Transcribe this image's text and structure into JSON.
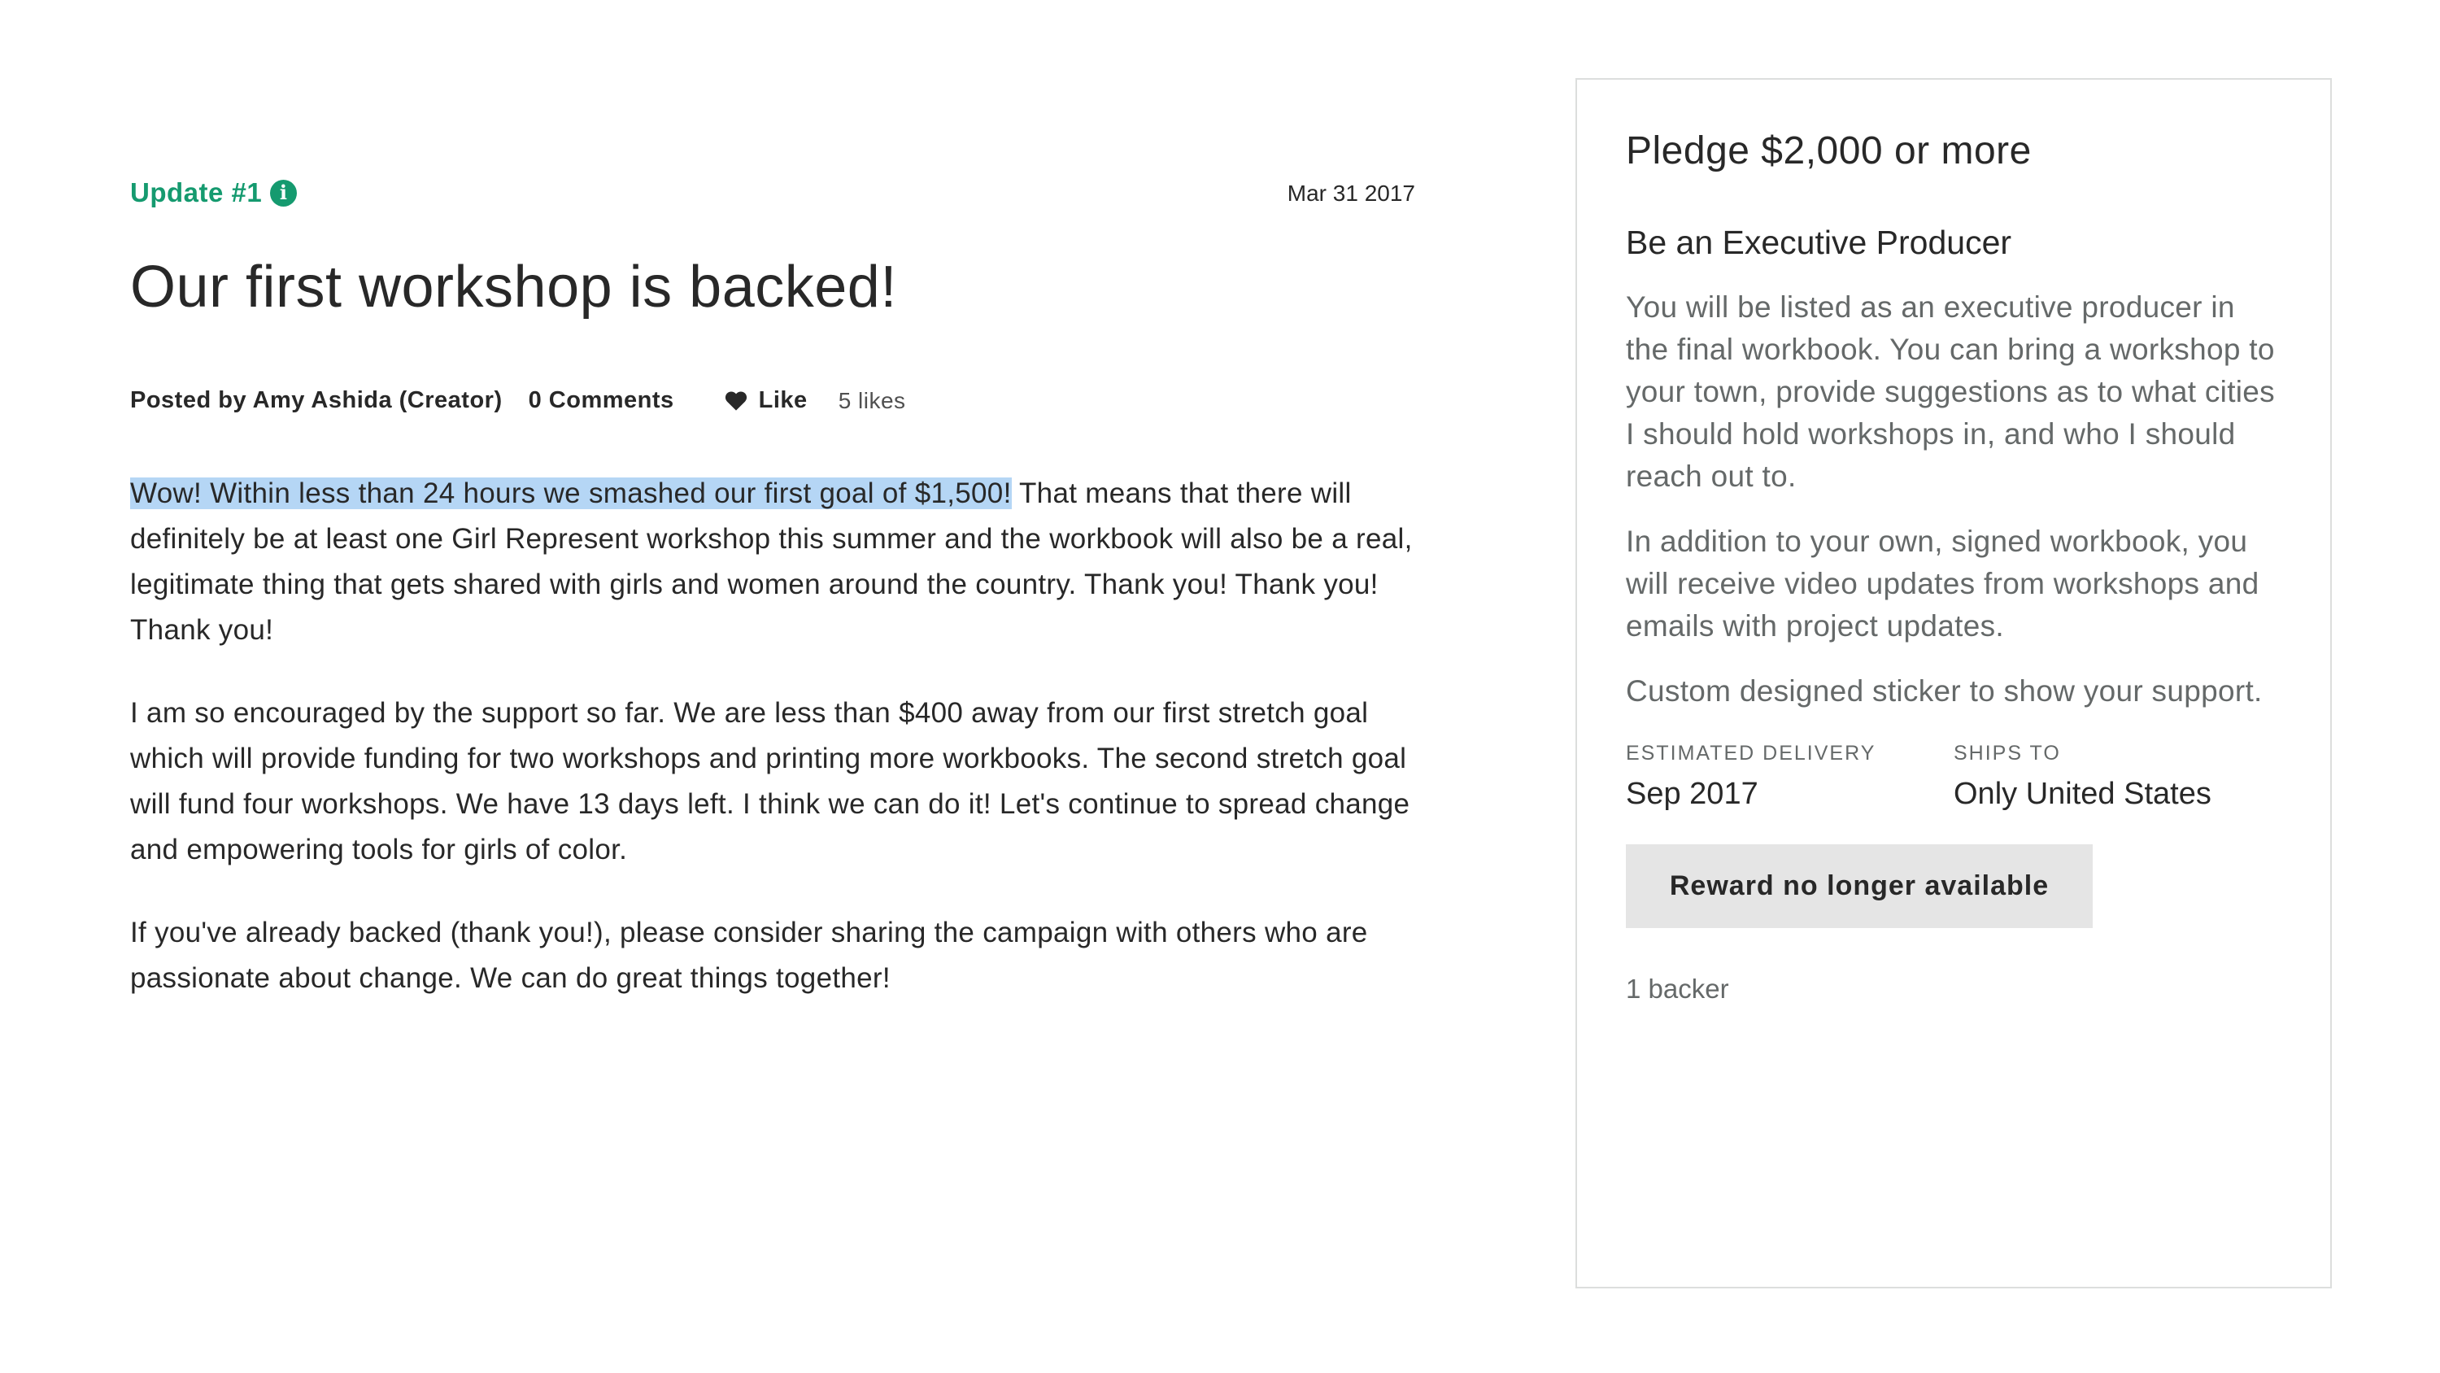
{
  "post": {
    "update_label": "Update #1",
    "date": "Mar 31 2017",
    "title": "Our first workshop is backed!",
    "author": "Posted by Amy Ashida (Creator)",
    "comments": "0 Comments",
    "like_label": "Like",
    "likes_count": "5 likes",
    "paragraph1_highlight": "Wow! Within less than 24 hours we smashed our first goal of $1,500!",
    "paragraph1_rest": " That means that there will definitely be at least one Girl Represent workshop this summer and the workbook will also be a real, legitimate thing that gets shared with girls and women around the country. Thank you! Thank you! Thank you!",
    "paragraph2": "I am so encouraged by the support so far. We are less than $400 away from our first stretch goal which will provide funding for two workshops and printing more workbooks. The second stretch goal will fund four workshops. We have 13 days left. I think we can do it! Let's continue to spread change and empowering tools for girls of color.",
    "paragraph3": "If you've already backed (thank you!), please consider sharing the campaign with others who are passionate about change. We can do great things together!"
  },
  "reward": {
    "pledge": "Pledge $2,000 or more",
    "title": "Be an Executive Producer",
    "desc1": "You will be listed as an executive producer in the final workbook. You can bring a workshop to your town, provide suggestions as to what cities I should hold workshops in, and who I should reach out to.",
    "desc2": "In addition to your own, signed workbook, you will receive video updates from workshops and emails with project updates.",
    "desc3": "Custom designed sticker to show your support.",
    "delivery_label": "Estimated delivery",
    "delivery_value": "Sep 2017",
    "ships_label": "Ships to",
    "ships_value": "Only United States",
    "button_label": "Reward no longer available",
    "backers": "1 backer"
  },
  "colors": {
    "accent_green": "#159a6f",
    "highlight": "#b5d6f5",
    "muted_text": "#656969",
    "button_bg": "#e5e5e5"
  },
  "icons": {
    "info": "info-icon",
    "heart": "heart-icon"
  }
}
